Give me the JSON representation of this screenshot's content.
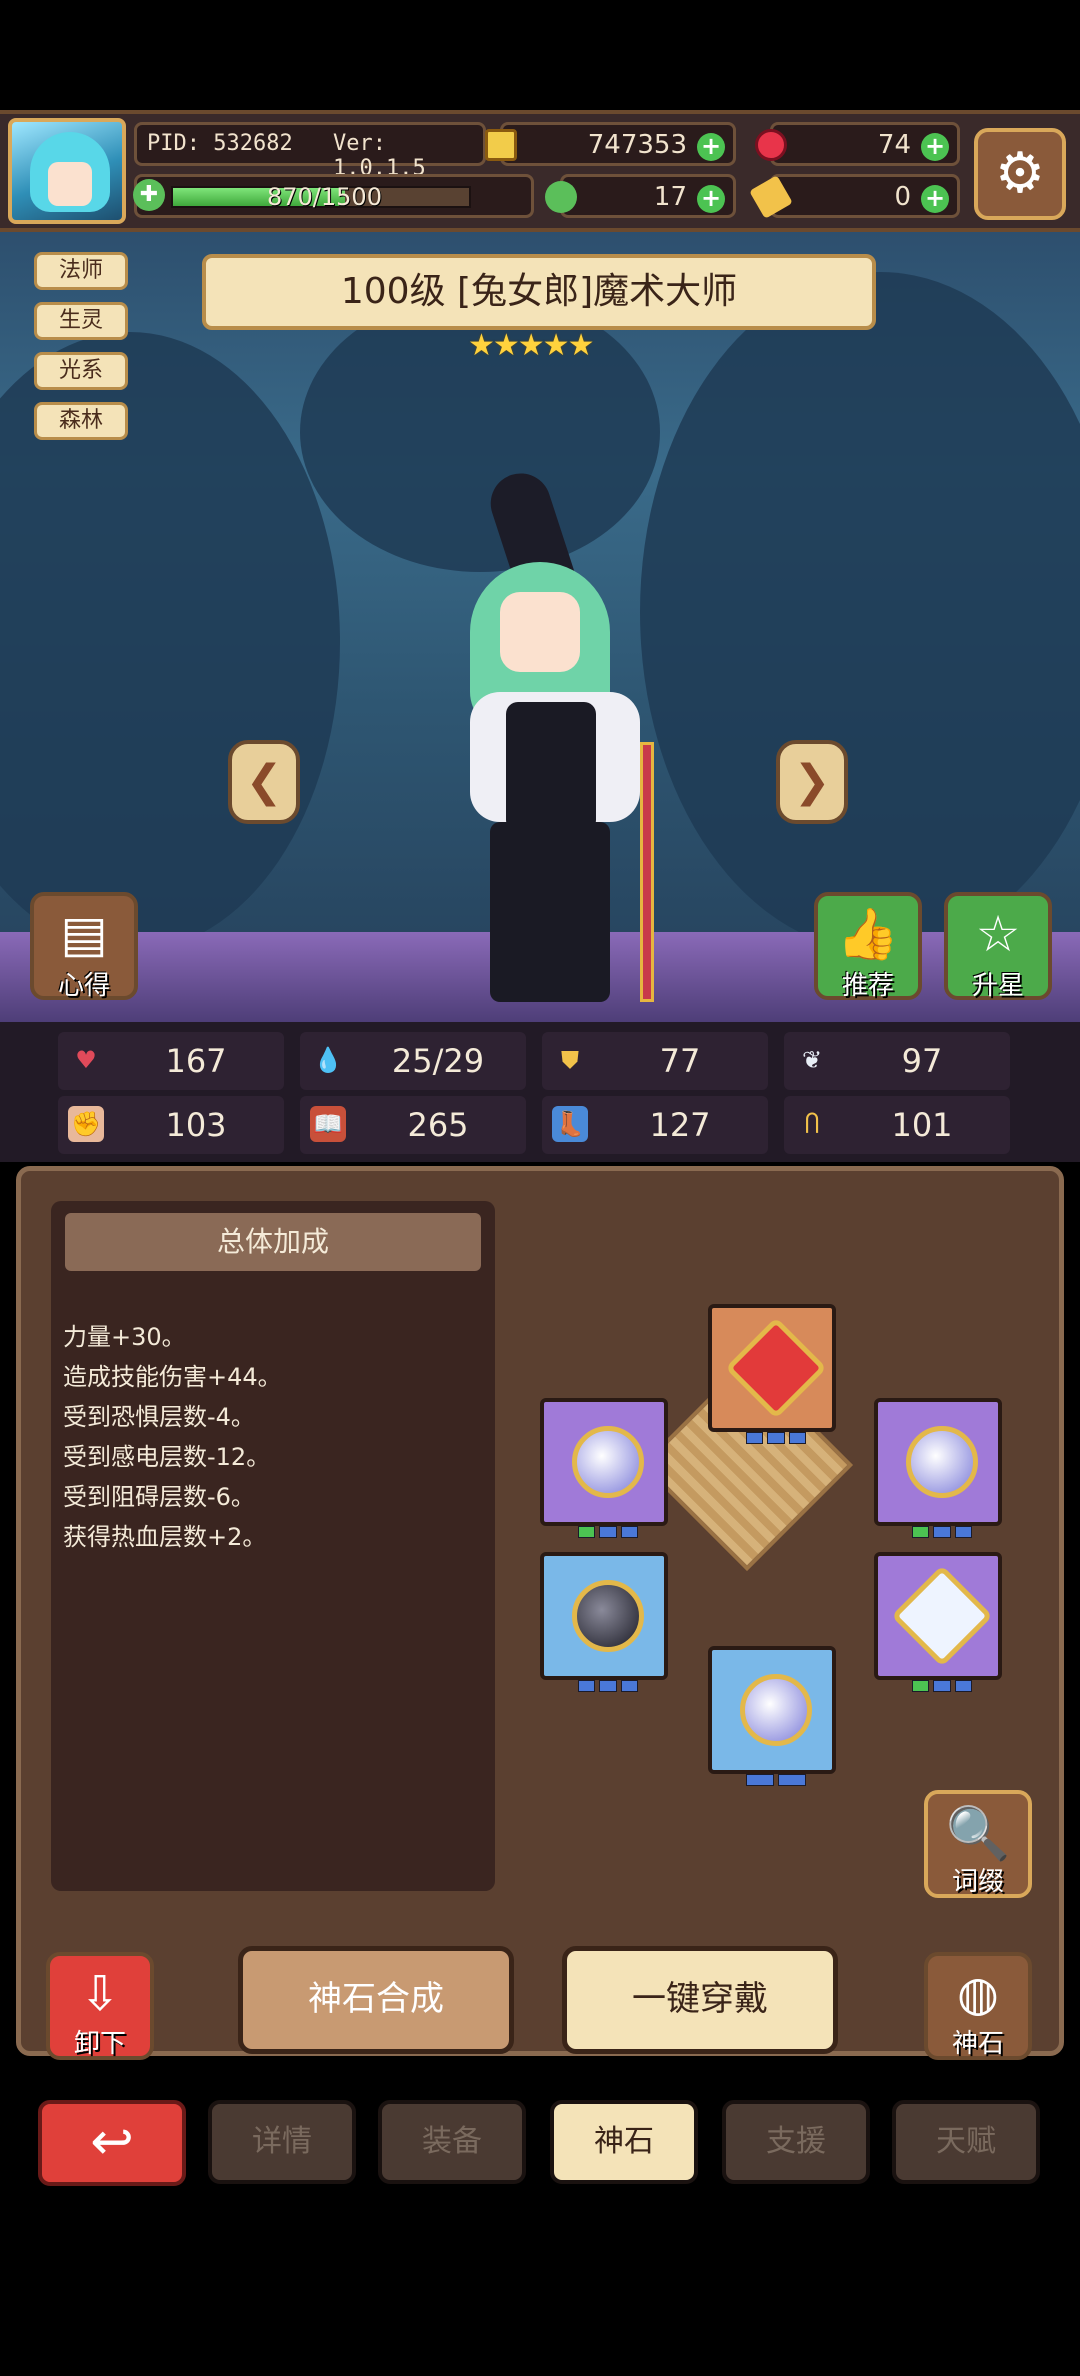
{
  "player": {
    "pid": "PID: 532682",
    "version": "Ver: 1.0.1.5",
    "xp": "870/1500",
    "xp_fraction": 0.58
  },
  "resources": {
    "gold": "747353",
    "gems": "74",
    "clover": "17",
    "ticket": "0"
  },
  "hero": {
    "tags": [
      "法师",
      "生灵",
      "光系",
      "森林"
    ],
    "title": "100级 [兔女郎]魔术大师",
    "stars": 5
  },
  "scene_buttons": {
    "insight": "心得",
    "recommend": "推荐",
    "star_up": "升星"
  },
  "stats": [
    {
      "icon": "heart-icon",
      "value": "167"
    },
    {
      "icon": "droplet-icon",
      "value": "25/29"
    },
    {
      "icon": "shield-icon",
      "value": "77"
    },
    {
      "icon": "wing-icon",
      "value": "97"
    },
    {
      "icon": "fist-icon",
      "value": "103"
    },
    {
      "icon": "book-icon",
      "value": "265"
    },
    {
      "icon": "boot-icon",
      "value": "127"
    },
    {
      "icon": "horseshoe-icon",
      "value": "101"
    }
  ],
  "bonus": {
    "title": "总体加成",
    "lines": [
      "力量+30。",
      "造成技能伤害+44。",
      "受到恐惧层数-4。",
      "受到感电层数-12。",
      "受到阻碍层数-6。",
      "获得热血层数+2。"
    ]
  },
  "affix_label": "词缀",
  "actions": {
    "unequip": "卸下",
    "synthesize": "神石合成",
    "equip_all": "一键穿戴",
    "godstone": "神石"
  },
  "tabs": [
    "详情",
    "装备",
    "神石",
    "支援",
    "天赋"
  ],
  "active_tab": "神石",
  "colors": {
    "accent_gold": "#d9a85a",
    "panel_brown": "#5b4030",
    "plus_green": "#4cc352",
    "back_red": "#e0403a"
  }
}
